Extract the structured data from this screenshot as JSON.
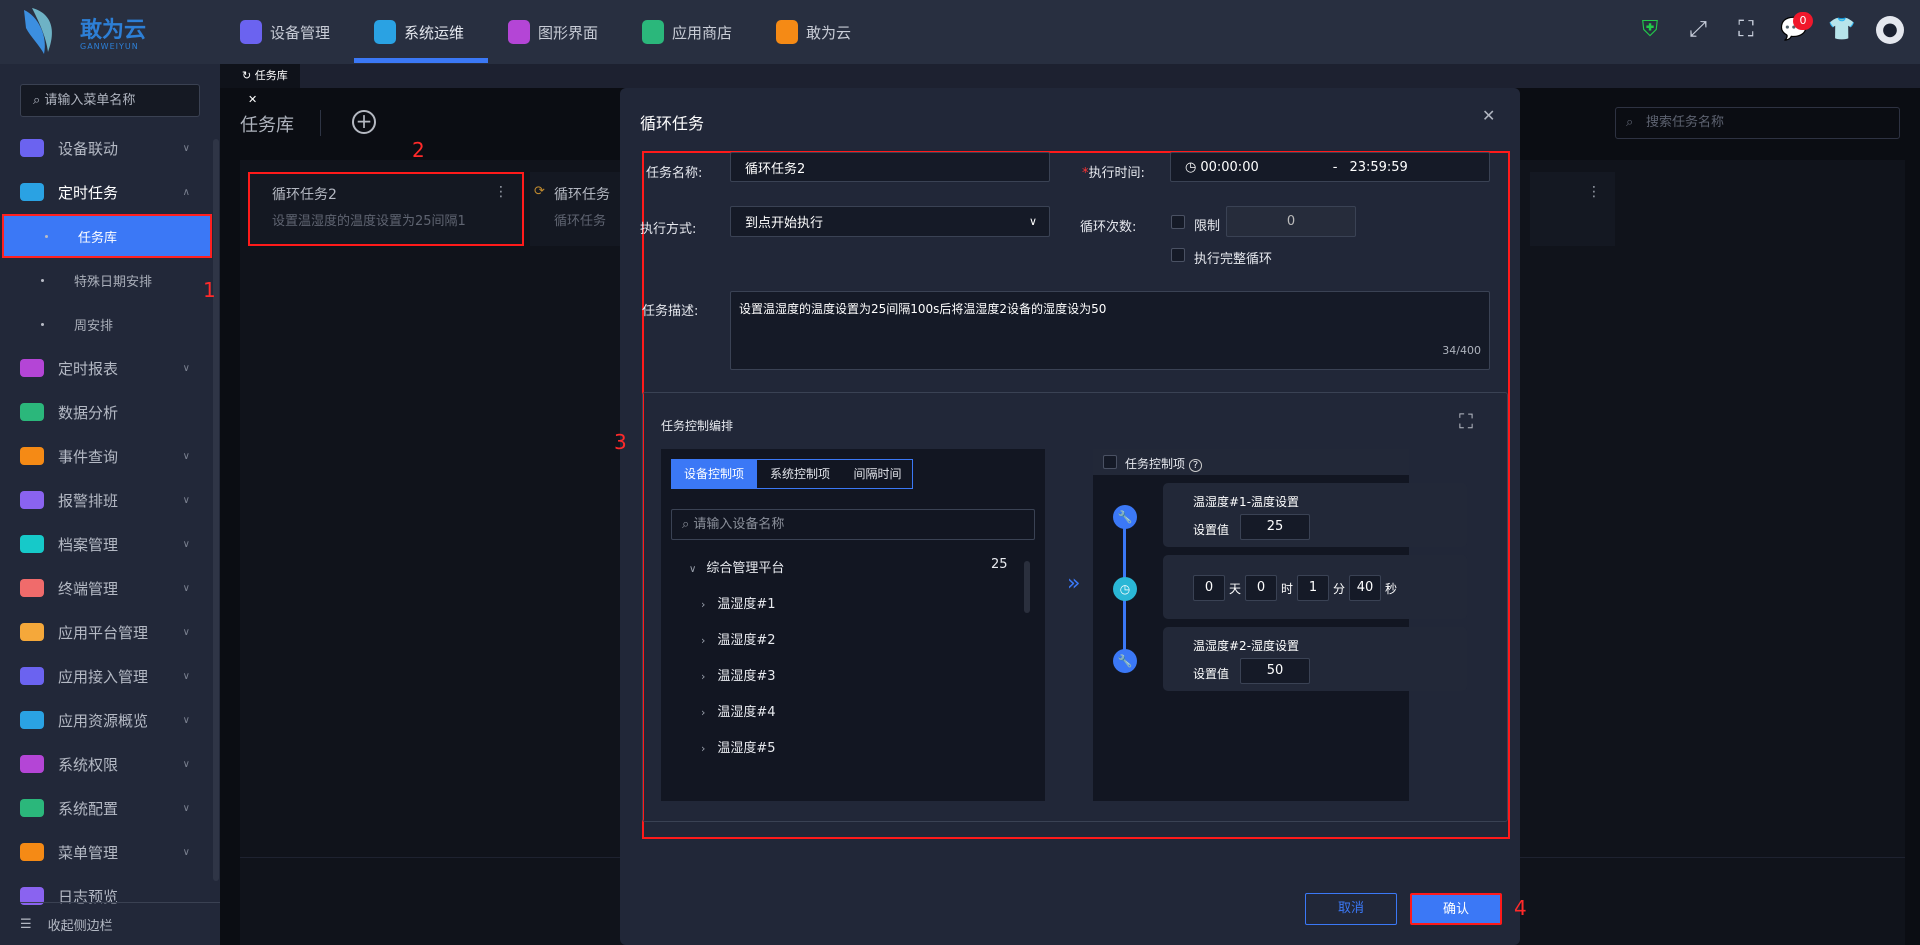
{
  "header": {
    "logo_text": "敢为云",
    "logo_sub": "GANWEIYUN",
    "nav": [
      {
        "label": "设备管理",
        "color": "#6b63f0"
      },
      {
        "label": "系统运维",
        "color": "#2aa2e3"
      },
      {
        "label": "图形界面",
        "color": "#b445d6"
      },
      {
        "label": "应用商店",
        "color": "#2bb77b"
      },
      {
        "label": "敢为云",
        "color": "#f58a15"
      }
    ],
    "active_nav": "系统运维",
    "notification_count": "0"
  },
  "tabbar": {
    "tabs": [
      {
        "label": "任务库"
      }
    ]
  },
  "sidebar": {
    "search_placeholder": "请输入菜单名称",
    "items": [
      {
        "label": "设备联动",
        "color": "#6b63f0"
      },
      {
        "label": "定时任务",
        "color": "#2aa2e3"
      },
      {
        "label": "定时报表",
        "color": "#b445d6"
      },
      {
        "label": "数据分析",
        "color": "#2bb77b"
      },
      {
        "label": "事件查询",
        "color": "#f58a15"
      },
      {
        "label": "报警排班",
        "color": "#8a63f0"
      },
      {
        "label": "档案管理",
        "color": "#16c9c9"
      },
      {
        "label": "终端管理",
        "color": "#f06b6b"
      },
      {
        "label": "应用平台管理",
        "color": "#f5a83a"
      },
      {
        "label": "应用接入管理",
        "color": "#6b63f0"
      },
      {
        "label": "应用资源概览",
        "color": "#2aa2e3"
      },
      {
        "label": "系统权限",
        "color": "#b445d6"
      },
      {
        "label": "系统配置",
        "color": "#2bb77b"
      },
      {
        "label": "菜单管理",
        "color": "#f58a15"
      },
      {
        "label": "日志预览",
        "color": "#8a63f0"
      }
    ],
    "sub_items": [
      "任务库",
      "特殊日期安排",
      "周安排"
    ],
    "collapse_label": "收起侧边栏"
  },
  "page": {
    "title": "任务库",
    "search_placeholder": "搜索任务名称",
    "cards": [
      {
        "title": "循环任务2",
        "desc": "设置温湿度的温度设置为25间隔1"
      },
      {
        "title": "循环任务",
        "desc": "循环任务"
      }
    ]
  },
  "annotations": [
    "1",
    "2",
    "3",
    "4"
  ],
  "modal": {
    "title": "循环任务",
    "form": {
      "name_label": "任务名称:",
      "name_value": "循环任务2",
      "time_label": "执行时间:",
      "time_start": "00:00:00",
      "time_sep": "-",
      "time_end": "23:59:59",
      "mode_label": "执行方式:",
      "mode_value": "到点开始执行",
      "loop_label": "循环次数:",
      "limit_label": "限制",
      "limit_value": "0",
      "full_loop_label": "执行完整循环",
      "desc_label": "任务描述:",
      "desc_value": "设置温湿度的温度设置为25间隔100s后将温湿度2设备的湿度设为50",
      "desc_count": "34/400"
    },
    "section": {
      "title": "任务控制编排",
      "tabs": [
        "设备控制项",
        "系统控制项",
        "间隔时间"
      ],
      "device_search_placeholder": "请输入设备名称",
      "tree_root": "综合管理平台",
      "tree_count": "25",
      "tree_items": [
        "温湿度#1",
        "温湿度#2",
        "温湿度#3",
        "温湿度#4",
        "温湿度#5"
      ],
      "control_header": "任务控制项",
      "steps": {
        "s1_title": "温湿度#1-温度设置",
        "s1_label": "设置值",
        "s1_value": "25",
        "days": "0",
        "days_unit": "天",
        "hours": "0",
        "hours_unit": "时",
        "minutes": "1",
        "minutes_unit": "分",
        "seconds": "40",
        "seconds_unit": "秒",
        "s3_title": "温湿度#2-湿度设置",
        "s3_label": "设置值",
        "s3_value": "50"
      }
    },
    "cancel_label": "取消",
    "confirm_label": "确认"
  }
}
